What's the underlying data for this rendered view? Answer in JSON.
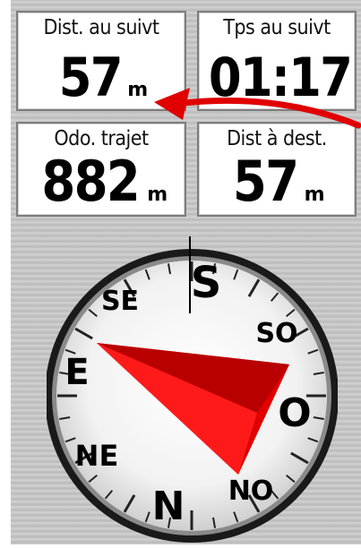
{
  "data_fields": [
    {
      "label": "Dist. au suivt",
      "value": "57",
      "unit": "m"
    },
    {
      "label": "Tps au suivt",
      "value": "01:17",
      "unit": ""
    },
    {
      "label": "Odo. trajet",
      "value": "882",
      "unit": "m"
    },
    {
      "label": "Dist à dest.",
      "value": "57",
      "unit": "m"
    }
  ],
  "compass": {
    "labels": {
      "n": "N",
      "s": "S",
      "e": "E",
      "o": "O",
      "se": "SE",
      "so": "SO",
      "ne": "NE",
      "no": "NO"
    },
    "pointer_icon": "bearing-pointer-icon",
    "pointer_color": "#e00000"
  },
  "annotation": {
    "icon": "curved-arrow-icon",
    "color": "#e00000"
  }
}
